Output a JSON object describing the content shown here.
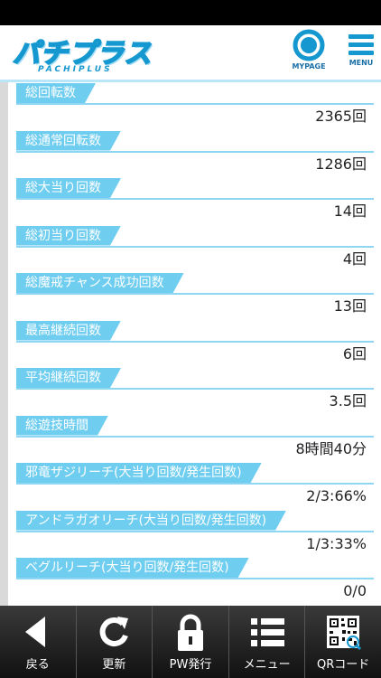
{
  "header": {
    "logo_text": "パチプラス",
    "logo_sub": "PACHIPLUS",
    "mypage_label": "MYPAGE",
    "menu_label": "MENU"
  },
  "stats": [
    {
      "label": "総回転数",
      "value": "2365回"
    },
    {
      "label": "総通常回転数",
      "value": "1286回"
    },
    {
      "label": "総大当り回数",
      "value": "14回"
    },
    {
      "label": "総初当り回数",
      "value": "4回"
    },
    {
      "label": "総魔戒チャンス成功回数",
      "value": "13回"
    },
    {
      "label": "最高継続回数",
      "value": "6回"
    },
    {
      "label": "平均継続回数",
      "value": "3.5回"
    },
    {
      "label": "総遊技時間",
      "value": "8時間40分"
    },
    {
      "label": "邪竜ザジリーチ(大当り回数/発生回数)",
      "value": "2/3:66%"
    },
    {
      "label": "アンドラガオリーチ(大当り回数/発生回数)",
      "value": "1/3:33%"
    },
    {
      "label": "ベグルリーチ(大当り回数/発生回数)",
      "value": "0/0"
    }
  ],
  "tabbar": {
    "back": "戻る",
    "refresh": "更新",
    "pw": "PW発行",
    "menu": "メニュー",
    "qr": "QRコード"
  },
  "colors": {
    "accent": "#6fcdf0",
    "logo": "#1597cf",
    "tabbar": "#222222"
  },
  "icons": {
    "back": "back-arrow-icon",
    "refresh": "refresh-icon",
    "pw": "lock-icon",
    "menu": "list-icon",
    "qr": "qr-code-icon"
  }
}
